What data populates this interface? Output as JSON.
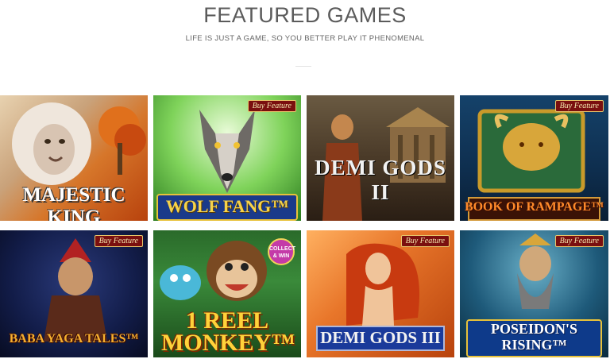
{
  "section": {
    "title": "FEATURED GAMES",
    "subtitle": "LIFE IS JUST A GAME, SO YOU BETTER PLAY IT PHENOMENAL"
  },
  "games": [
    {
      "name": "MAJESTIC KING",
      "badge": ""
    },
    {
      "name": "WOLF FANG™",
      "badge": "Buy Feature"
    },
    {
      "name": "DEMI GODS II",
      "badge": ""
    },
    {
      "name": "BOOK OF RAMPAGE™",
      "badge": "Buy Feature"
    },
    {
      "name": "BABA YAGA TALES™",
      "badge": "Buy Feature"
    },
    {
      "name": "1 REEL MONKEY™",
      "badge": "",
      "sticker": "COLLECT & WIN"
    },
    {
      "name": "DEMI GODS III",
      "badge": "Buy Feature"
    },
    {
      "name": "POSEIDON'S RISING™",
      "badge": "Buy Feature"
    }
  ]
}
